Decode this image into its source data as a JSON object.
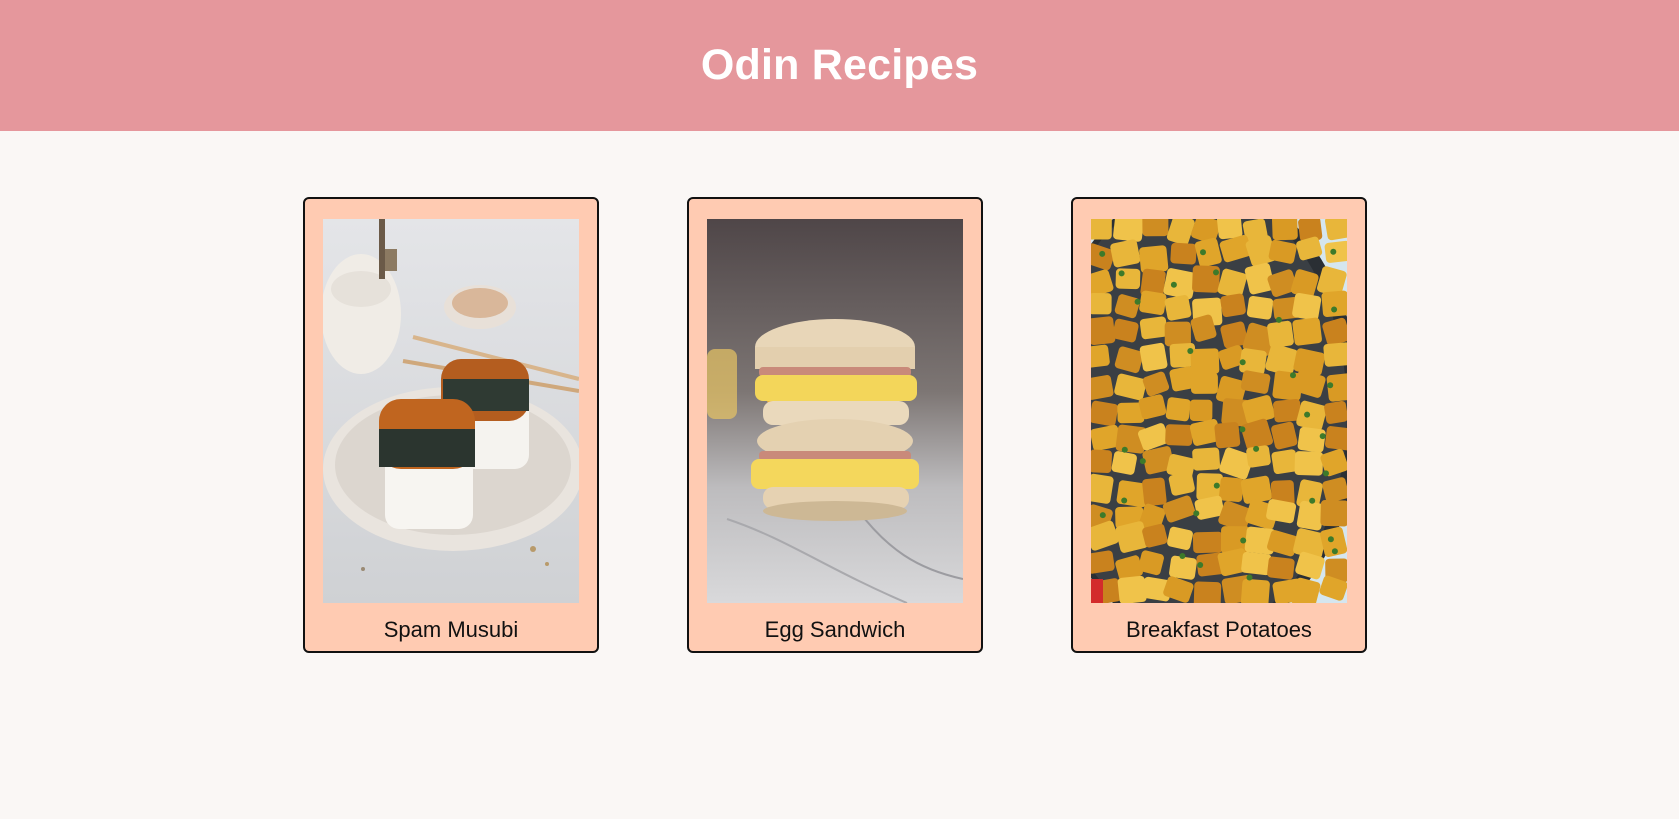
{
  "header": {
    "title": "Odin Recipes",
    "background_color": "#e5979c"
  },
  "recipes": [
    {
      "name": "Spam Musubi",
      "image_subject": "spam-musubi-photo"
    },
    {
      "name": "Egg Sandwich",
      "image_subject": "egg-sandwich-photo"
    },
    {
      "name": "Breakfast Potatoes",
      "image_subject": "breakfast-potatoes-photo"
    }
  ],
  "colors": {
    "page_background": "#faf7f5",
    "card_background": "#ffcbb2",
    "card_border": "#111111"
  }
}
